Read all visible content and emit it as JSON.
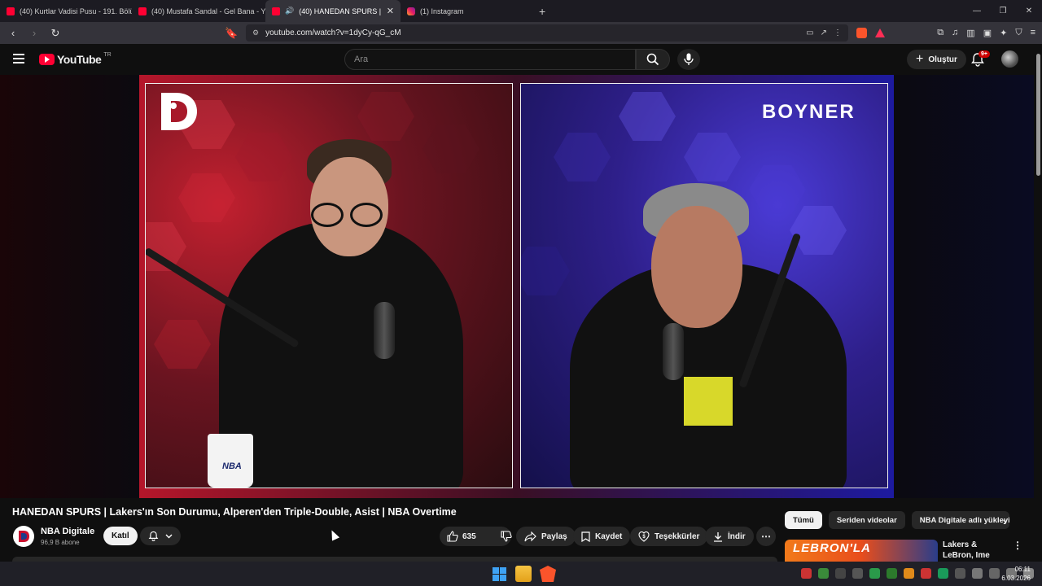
{
  "browser": {
    "tabs": [
      {
        "title": "(40) Kurtlar Vadisi Pusu - 191. Bölüm",
        "favicon": "youtube-favicon",
        "active": false
      },
      {
        "title": "(40) Mustafa Sandal - Gel Bana - You",
        "favicon": "youtube-favicon",
        "active": false
      },
      {
        "title": "(40) HANEDAN SPURS | Lakers",
        "favicon": "youtube-favicon",
        "active": true
      },
      {
        "title": "(1) Instagram",
        "favicon": "instagram-favicon",
        "active": false
      }
    ],
    "new_tab": "+",
    "url": "youtube.com/watch?v=1dyCy-qG_cM"
  },
  "youtube": {
    "logo_text": "YouTube",
    "region": "TR",
    "search_placeholder": "Ara",
    "create_label": "Oluştur",
    "notification_count": "9+"
  },
  "video": {
    "overlay_brand": "BOYNER",
    "mug_text": "NBA",
    "title": "HANEDAN SPURS | Lakers'ın Son Durumu, Alperen'den Triple-Double, Asist | NBA Overtime",
    "channel_name": "NBA Digitale",
    "subscribers": "96,9 B abone",
    "join_label": "Katıl",
    "like_count": "635",
    "share_label": "Paylaş",
    "save_label": "Kaydet",
    "thanks_label": "Teşekkürler",
    "download_label": "İndir"
  },
  "sidebar": {
    "chips": [
      "Tümü",
      "Seriden videolar",
      "NBA Digitale adlı yükleyici"
    ],
    "recommended": {
      "thumb_text": "LEBRON'LA",
      "title": "Lakers & LeBron, Ime Udoka, Hard..."
    }
  },
  "taskbar": {
    "time": "06:11",
    "date": "6.03.2026"
  },
  "colors": {
    "youtube_red": "#ff0033",
    "brave_orange": "#fb542b",
    "background": "#0f0f0f"
  }
}
